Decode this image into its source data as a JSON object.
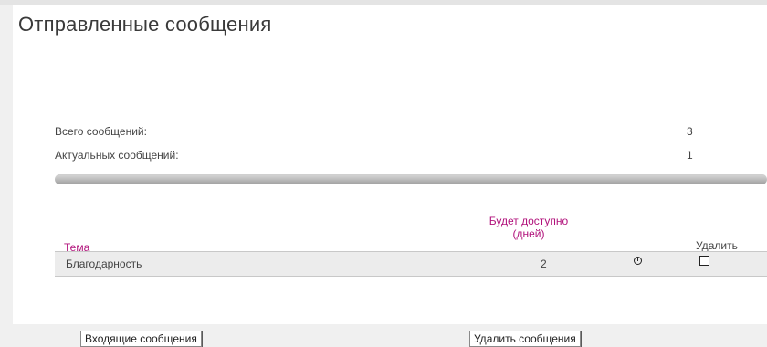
{
  "page": {
    "title": "Отправленные сообщения"
  },
  "stats": [
    {
      "label": "Всего сообщений:",
      "value": "3"
    },
    {
      "label": "Актуальных сообщений:",
      "value": "1"
    }
  ],
  "table": {
    "headers": {
      "subject": "Тема",
      "available_line1": "Будет доступно",
      "available_line2": "(дней)",
      "delete": "Удалить"
    },
    "rows": [
      {
        "subject": "Благодарность",
        "days": "2",
        "status_icon": "timer-icon",
        "delete_checked": false
      }
    ]
  },
  "buttons": {
    "inbox": "Входящие сообщения",
    "delete": "Удалить сообщения"
  },
  "colors": {
    "header_accent": "#b1127b"
  }
}
